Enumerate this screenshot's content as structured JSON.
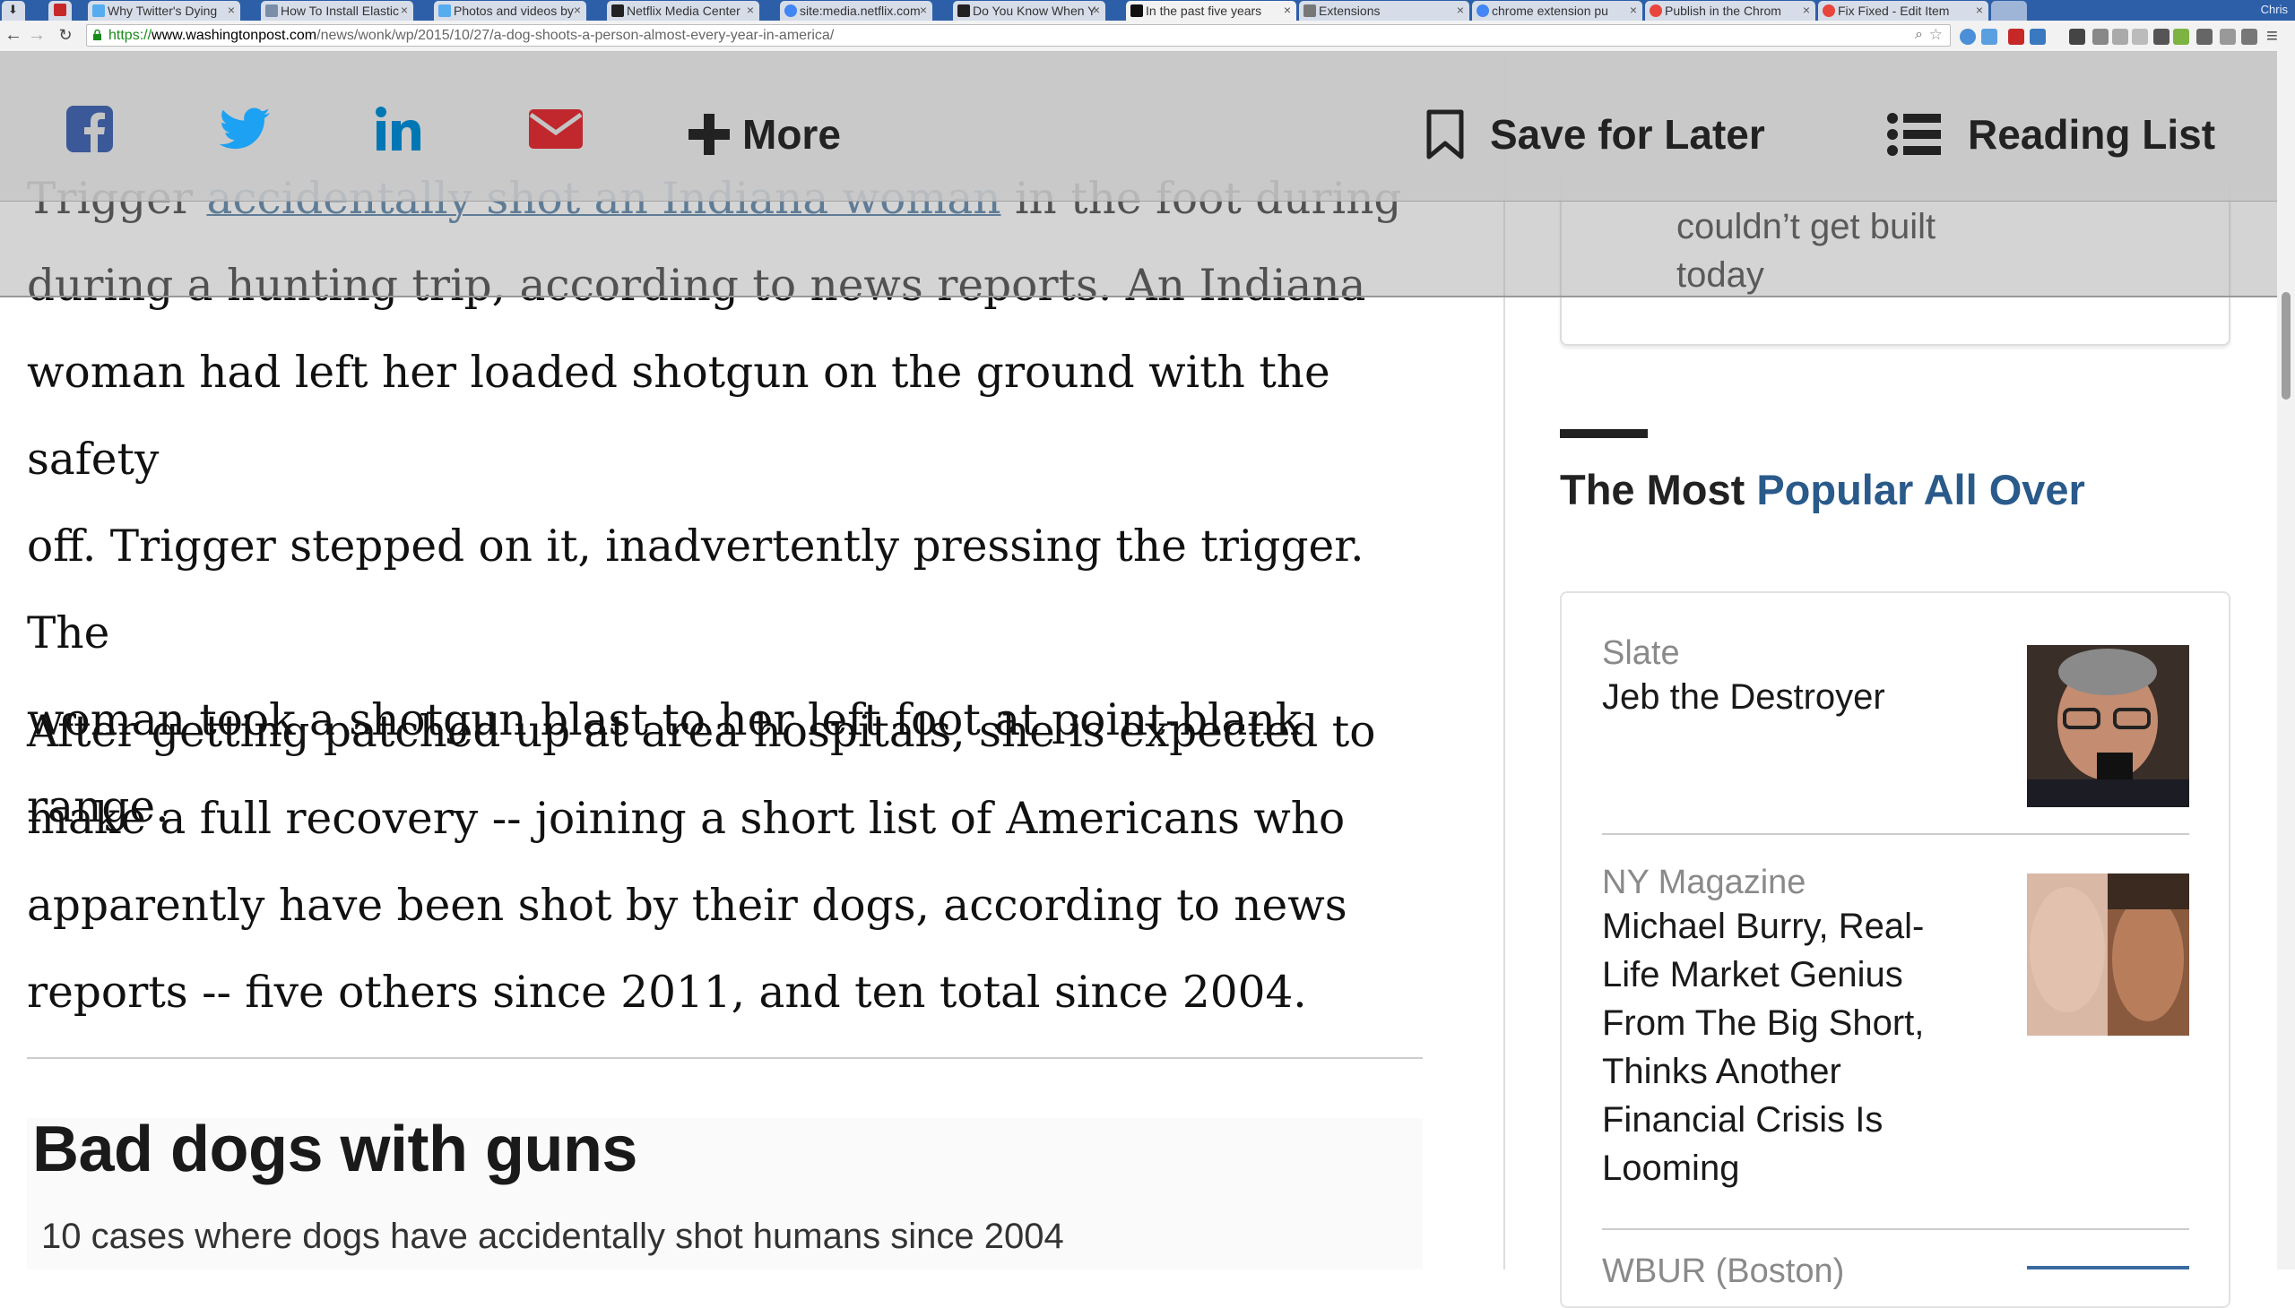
{
  "browser": {
    "tabs": [
      {
        "title": "Why Twitter's Dying",
        "favicon_color": "#55acee"
      },
      {
        "title": "How To Install Elastic",
        "favicon_color": "#7a8ea8"
      },
      {
        "title": "Photos and videos by",
        "favicon_color": "#55acee"
      },
      {
        "title": "Netflix Media Center",
        "favicon_color": "#222222"
      },
      {
        "title": "site:media.netflix.com",
        "favicon_color": "#4285f4"
      },
      {
        "title": "Do You Know When Y",
        "favicon_color": "#222222"
      },
      {
        "title": "In the past five years",
        "favicon_color": "#111111"
      },
      {
        "title": "Extensions",
        "favicon_color": "#777777"
      },
      {
        "title": "chrome extension pu",
        "favicon_color": "#4285f4"
      },
      {
        "title": "Publish in the Chrom",
        "favicon_color": "#e8453c"
      },
      {
        "title": "Fix Fixed - Edit Item",
        "favicon_color": "#e8453c"
      }
    ],
    "profile_name": "Chris",
    "url": {
      "scheme": "https://",
      "host": "www.washingtonpost.com",
      "path": "/news/wonk/wp/2015/10/27/a-dog-shoots-a-person-almost-every-year-in-america/"
    }
  },
  "sharebar": {
    "more_label": "More",
    "save_label": "Save for Later",
    "reading_label": "Reading List",
    "colors": {
      "facebook": "#3b5998",
      "twitter": "#1da1f2",
      "linkedin": "#0077b5",
      "email": "#c0282d"
    }
  },
  "article": {
    "para1": {
      "line1_before": "Trigger",
      "line1_link": "accidentally shot an Indiana woman",
      "line1_after": " in the foot during",
      "line2": "during a hunting trip, according to news reports. An Indiana",
      "line3": "woman had left her loaded shotgun on the ground with the safety",
      "line4": "off. Trigger stepped on it, inadvertently pressing the trigger. The",
      "line5": "woman took a shotgun blast to her left foot at point-blank range."
    },
    "para2": {
      "line1": "After getting patched up at area hospitals, she is expected to",
      "line2": "make a full recovery -- joining a short list of Americans who",
      "line3": "apparently have been shot by their dogs, according to news",
      "line4": "reports -- five others since 2011, and ten total since 2004."
    },
    "graphic": {
      "title": "Bad dogs with guns",
      "subtitle": "10 cases where dogs have accidentally shot humans since 2004"
    }
  },
  "sidebar": {
    "previous_item_text_line1": "couldn’t get built",
    "previous_item_text_line2": "today",
    "popular_heading_prefix": "The Most ",
    "popular_heading_accent": "Popular All Over",
    "items": [
      {
        "source": "Slate",
        "headline": "Jeb the Destroyer"
      },
      {
        "source": "NY Magazine",
        "headline": "Michael Burry, Real-Life Market Genius From The Big Short, Thinks Another Financial Crisis Is Looming"
      },
      {
        "source": "WBUR (Boston)",
        "headline": ""
      }
    ]
  }
}
